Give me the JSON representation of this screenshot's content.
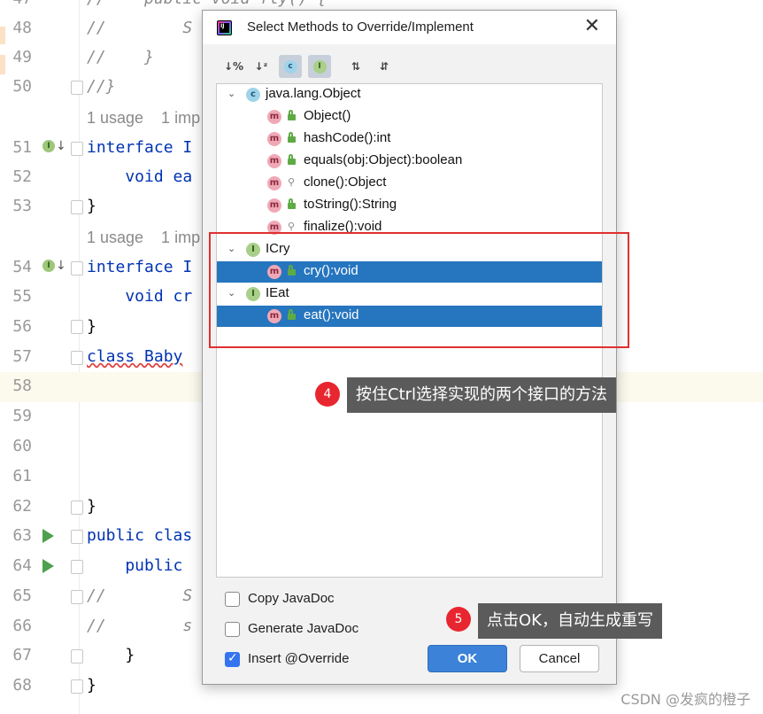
{
  "editor": {
    "lines": [
      {
        "num": "47",
        "code": "//    public void fly() {"
      },
      {
        "num": "48",
        "code": "//        S"
      },
      {
        "num": "49",
        "code": "//    }"
      },
      {
        "num": "50",
        "code": "//}"
      },
      {
        "num": "51",
        "code": "interface I"
      },
      {
        "num": "52",
        "code": "    void ea"
      },
      {
        "num": "53",
        "code": "}"
      },
      {
        "num": "54",
        "code": "interface I"
      },
      {
        "num": "55",
        "code": "    void cr"
      },
      {
        "num": "56",
        "code": "}"
      },
      {
        "num": "57",
        "code": "class Baby"
      },
      {
        "num": "58",
        "code": ""
      },
      {
        "num": "59",
        "code": ""
      },
      {
        "num": "60",
        "code": ""
      },
      {
        "num": "61",
        "code": ""
      },
      {
        "num": "62",
        "code": "}"
      },
      {
        "num": "63",
        "code": "public clas"
      },
      {
        "num": "64",
        "code": "    public"
      },
      {
        "num": "65",
        "code": "//        S"
      },
      {
        "num": "66",
        "code": "//        s"
      },
      {
        "num": "67",
        "code": "    }"
      },
      {
        "num": "68",
        "code": "}"
      }
    ],
    "hint_1": "1 usage    1 imp",
    "hint_2": "1 usage    1 imp"
  },
  "dialog": {
    "title": "Select Methods to Override/Implement",
    "toolbar": {
      "sort_visibility": "↓%",
      "sort_alpha": "↓ᶻ",
      "show_classes": "c",
      "show_interfaces": "I",
      "expand_all": "⇅",
      "collapse_all": "⇵"
    },
    "tree": {
      "object_group": "java.lang.Object",
      "object_methods": [
        "Object()",
        "hashCode():int",
        "equals(obj:Object):boolean",
        "clone():Object",
        "toString():String",
        "finalize():void"
      ],
      "icry_group": "ICry",
      "icry_method": "cry():void",
      "ieat_group": "IEat",
      "ieat_method": "eat():void"
    },
    "options": {
      "copy_javadoc": "Copy JavaDoc",
      "generate_javadoc": "Generate JavaDoc",
      "insert_override": "Insert @Override"
    },
    "buttons": {
      "ok": "OK",
      "cancel": "Cancel"
    }
  },
  "annotations": {
    "step4_num": "4",
    "step4_text": "按住Ctrl选择实现的两个接口的方法",
    "step5_num": "5",
    "step5_text": "点击OK，自动生成重写"
  },
  "watermark": "CSDN @发疯的橙子",
  "colors": {
    "selection": "#2675bf",
    "keyword": "#0033b3",
    "annotation_red": "#e8262f",
    "ok_button": "#3c82d8"
  }
}
